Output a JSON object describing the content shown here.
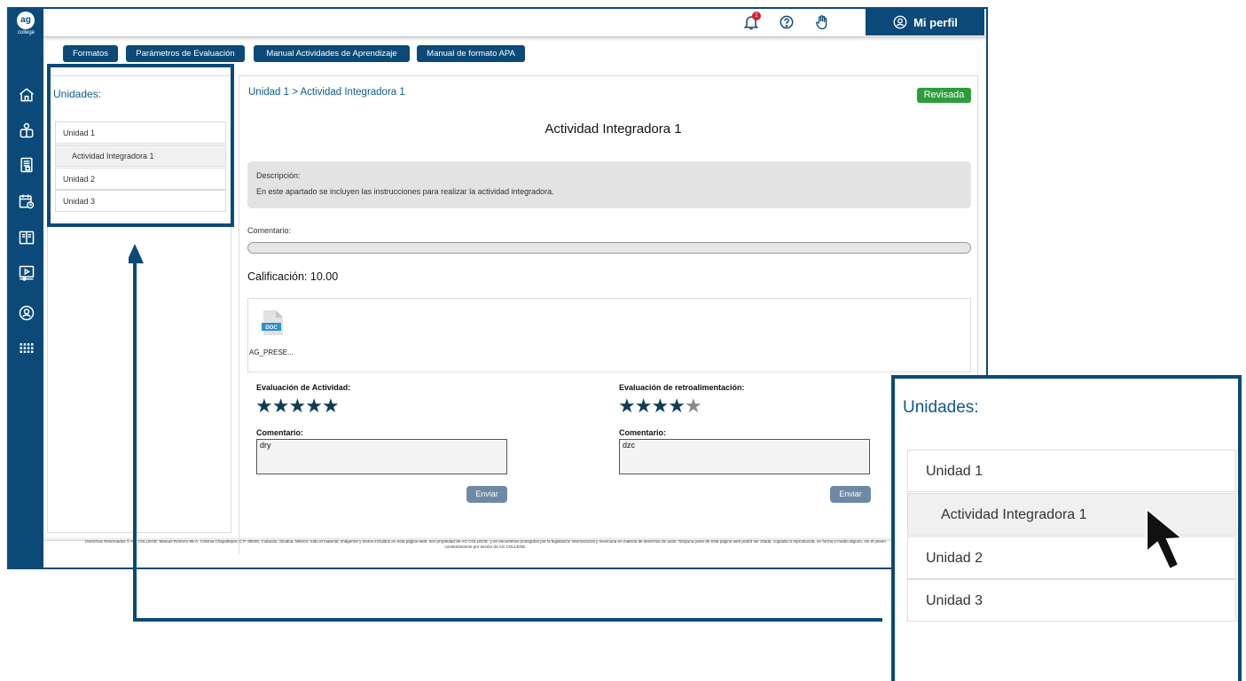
{
  "brand": {
    "logo_text": "ag",
    "logo_sub": "college"
  },
  "header": {
    "notification_count": "1",
    "profile_label": "Mi perfil"
  },
  "tabs": [
    "Formatos",
    "Parámetros de Evaluación",
    "Manual Actividades de Aprendizaje",
    "Manual de formato APA"
  ],
  "sidebar_icons": [
    "home-icon",
    "courses-icon",
    "document-icon",
    "calendar-icon",
    "library-icon",
    "video-icon",
    "account-icon",
    "apps-grid-icon"
  ],
  "units": {
    "title": "Unidades:",
    "items": [
      "Unidad 1",
      "Actividad Integradora 1",
      "Unidad 2",
      "Unidad 3"
    ]
  },
  "main": {
    "breadcrumb": "Unidad 1 > Actividad Integradora 1",
    "status": "Revisada",
    "title": "Actividad Integradora 1",
    "description_label": "Descripción:",
    "description_text": "En este apartado se incluyen las instrucciones para realizar la actividad integradora.",
    "comment_label": "Comentario:",
    "grade": "Calificación: 10.00",
    "file_type": "DOC",
    "file_name": "AG_PRESE..."
  },
  "evaluations": [
    {
      "label": "Evaluación de Actividad:",
      "rating": 5,
      "max": 5,
      "comment_label": "Comentario:",
      "comment": "dry",
      "send": "Enviar"
    },
    {
      "label": "Evaluación de retroalimentación:",
      "rating": 4,
      "max": 5,
      "comment_label": "Comentario:",
      "comment": "dzc",
      "send": "Enviar"
    }
  ],
  "footer": {
    "text": "Derechos Reservados © AG COLLEGE; Manuel Romero 96-A, Colonia Chapultepec C.P. 80040, Culiacán, Sinaloa, México; todo el material, imágenes y textos incluidos en esta página web, son propiedad de AG COLLEGE, y se encuentran protegidos por la legislación internacional y mexicana en materia de derechos de autor. Ninguna parte de esta página web podrá ser citada, copiada ni reproducida, en forma o medio alguno, sin el previo consentimiento por escrito de AG COLLEGE."
  },
  "colors": {
    "primary": "#0b4a78",
    "success": "#2e9c3b",
    "button_muted": "#6d89a6",
    "badge": "#d3202f"
  }
}
